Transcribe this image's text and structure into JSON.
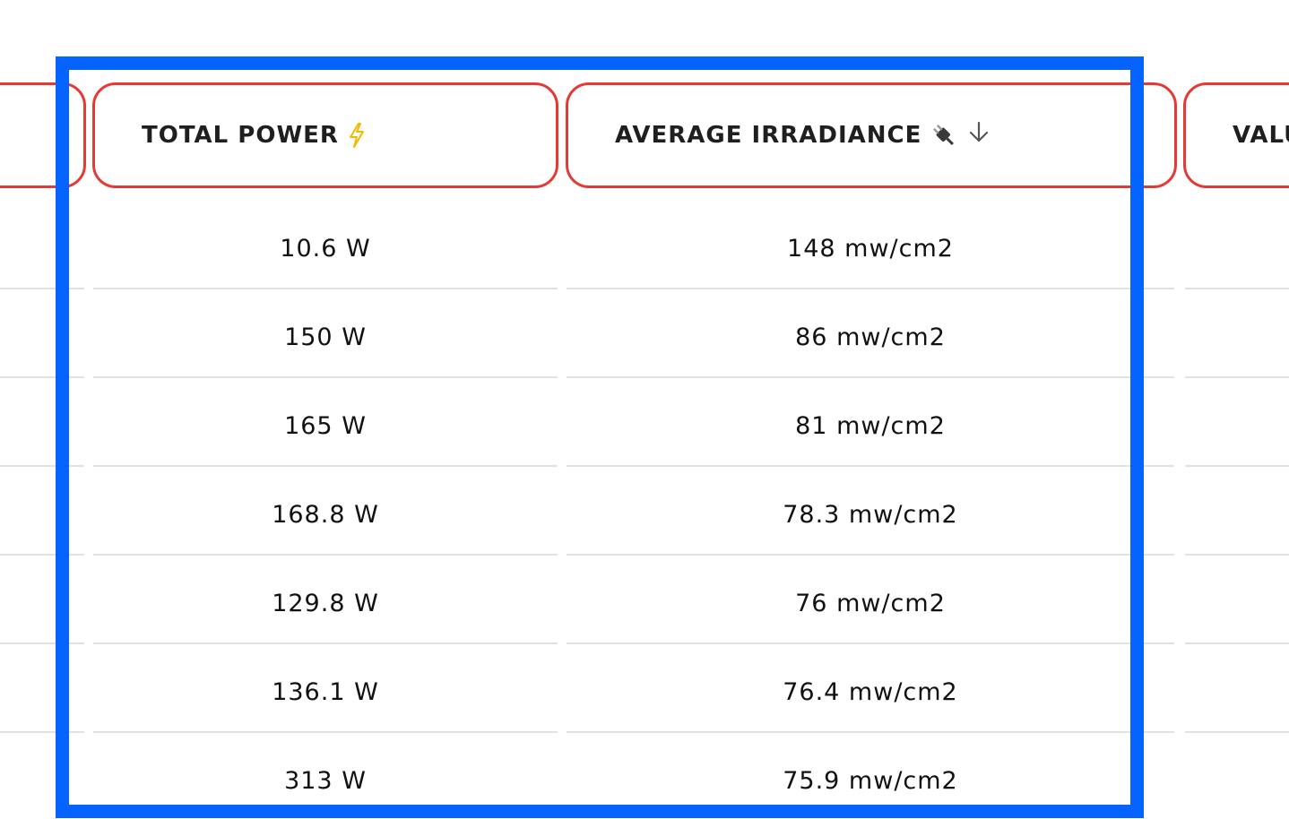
{
  "table": {
    "headers": {
      "left": "",
      "power": "TOTAL POWER",
      "irradiance": "AVERAGE IRRADIANCE",
      "value": "VALU"
    },
    "icons": {
      "power": "lightning-bolt-icon",
      "irradiance": "electric-plug-icon",
      "sort": "arrow-down-icon"
    },
    "colors": {
      "header_border": "#e53935",
      "highlight": "#0563ff",
      "bolt": "#f5b800"
    },
    "rows": [
      {
        "power": "10.6 W",
        "irradiance": "148 mw/cm2"
      },
      {
        "power": "150 W",
        "irradiance": "86 mw/cm2"
      },
      {
        "power": "165 W",
        "irradiance": "81 mw/cm2"
      },
      {
        "power": "168.8 W",
        "irradiance": "78.3 mw/cm2"
      },
      {
        "power": "129.8 W",
        "irradiance": "76 mw/cm2"
      },
      {
        "power": "136.1 W",
        "irradiance": "76.4 mw/cm2"
      },
      {
        "power": "313 W",
        "irradiance": "75.9 mw/cm2"
      }
    ]
  }
}
